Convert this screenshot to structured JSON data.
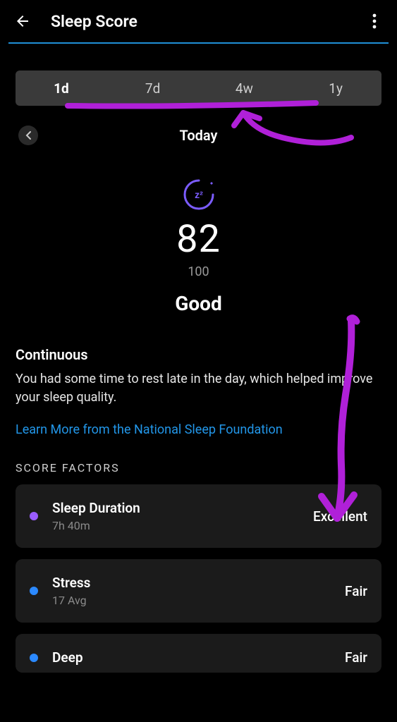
{
  "header": {
    "title": "Sleep Score"
  },
  "tabs": {
    "items": [
      "1d",
      "7d",
      "4w",
      "1y"
    ],
    "active_index": 0
  },
  "date": {
    "label": "Today"
  },
  "score": {
    "value": "82",
    "max": "100",
    "label": "Good"
  },
  "continuous": {
    "title": "Continuous",
    "body": "You had some time to rest late in the day, which helped improve your sleep quality.",
    "link": "Learn More from the National Sleep Foundation"
  },
  "factors": {
    "header": "SCORE FACTORS",
    "items": [
      {
        "color": "#9a5cff",
        "title": "Sleep Duration",
        "sub": "7h 40m",
        "rating": "Excellent"
      },
      {
        "color": "#2b89ff",
        "title": "Stress",
        "sub": "17 Avg",
        "rating": "Fair"
      },
      {
        "color": "#2b89ff",
        "title": "Deep",
        "sub": "",
        "rating": "Fair"
      }
    ]
  }
}
